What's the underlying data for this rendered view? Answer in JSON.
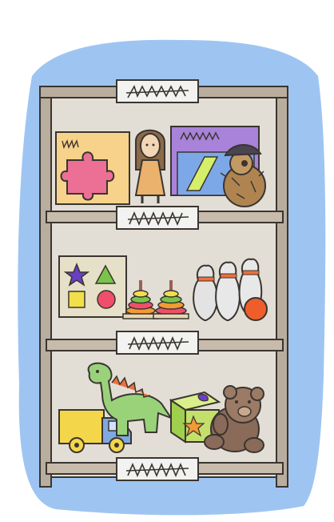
{
  "illustration": {
    "subject": "toy-shelf",
    "colors": {
      "background_blob": "#9ec5f2",
      "shelf_frame": "#b9ad9e",
      "shelf_back": "#e3ded5",
      "outline": "#3a3530",
      "label_card": "#f2f2f0",
      "puzzle_board": "#f7d28a",
      "puzzle_piece": "#ec6f95",
      "doll_dress": "#eab26d",
      "game_board": "#a883d9",
      "teddy_small": "#b08450",
      "shape_star": "#6a3fc4",
      "shape_triangle": "#7bc44a",
      "shape_square": "#f1e04a",
      "shape_circle": "#ef4f6b",
      "bowling_ball": "#ef5e2a",
      "truck_yellow": "#f4d64a",
      "truck_blue": "#7fa8e0",
      "dino": "#9ad27a",
      "block": "#c4df6c",
      "bear": "#8a6a58"
    },
    "shelves": [
      {
        "items": [
          "puzzle-board",
          "doll",
          "board-game",
          "pirate-teddy"
        ]
      },
      {
        "items": [
          "shape-sorter",
          "stacking-ring-tower",
          "stacking-ring-tower",
          "bowling-pins",
          "bowling-ball"
        ]
      },
      {
        "items": [
          "toy-truck",
          "toy-dinosaur",
          "shape-block",
          "teddy-bear"
        ]
      }
    ]
  }
}
